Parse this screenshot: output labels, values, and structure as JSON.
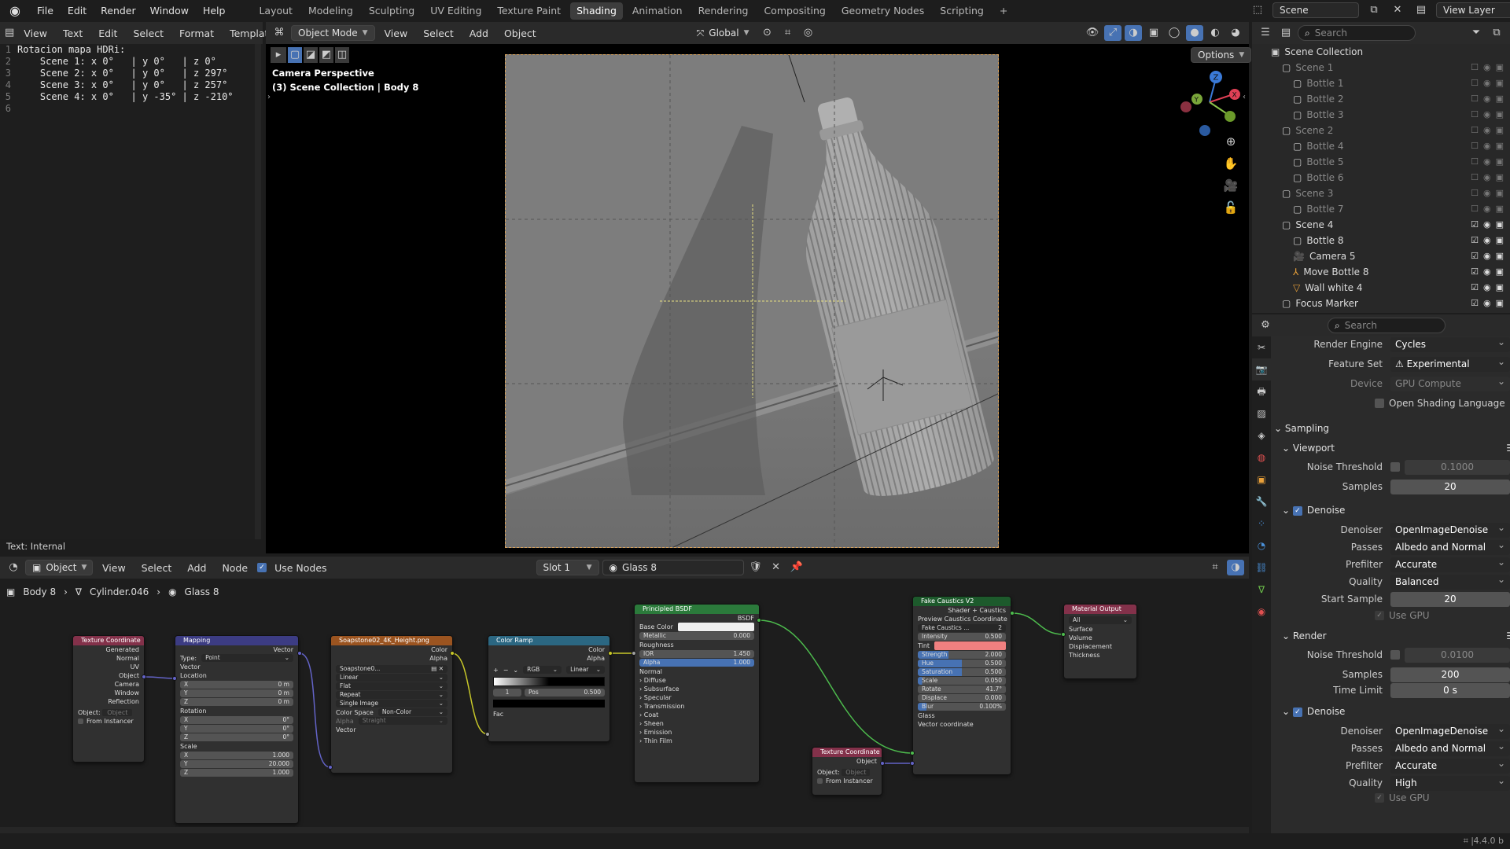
{
  "topbar": {
    "menus": [
      "File",
      "Edit",
      "Render",
      "Window",
      "Help"
    ],
    "workspaces": [
      "Layout",
      "Modeling",
      "Sculpting",
      "UV Editing",
      "Texture Paint",
      "Shading",
      "Animation",
      "Rendering",
      "Compositing",
      "Geometry Nodes",
      "Scripting"
    ],
    "active_workspace": "Shading",
    "scene": "Scene",
    "view_layer": "View Layer"
  },
  "text_editor": {
    "menus": [
      "View",
      "Text",
      "Edit",
      "Select",
      "Format",
      "Templates"
    ],
    "lines": [
      {
        "num": "1",
        "text": "Rotacion mapa HDRi:"
      },
      {
        "num": "2",
        "text": "    Scene 1: x 0°   | y 0°   | z 0°"
      },
      {
        "num": "3",
        "text": "    Scene 2: x 0°   | y 0°   | z 297°"
      },
      {
        "num": "4",
        "text": "    Scene 3: x 0°   | y 0°   | z 257°"
      },
      {
        "num": "5",
        "text": "    Scene 4: x 0°   | y -35° | z -210°"
      },
      {
        "num": "6",
        "text": ""
      }
    ],
    "status": "Text: Internal"
  },
  "viewport": {
    "mode": "Object Mode",
    "menus": [
      "View",
      "Select",
      "Add",
      "Object"
    ],
    "transform": "Global",
    "options": "Options",
    "overlay_title": "Camera Perspective",
    "overlay_sub": "(3) Scene Collection | Body 8",
    "axes": [
      "Z",
      "Y",
      "X"
    ]
  },
  "node_editor": {
    "type": "Object",
    "menus": [
      "View",
      "Select",
      "Add",
      "Node"
    ],
    "use_nodes": "Use Nodes",
    "slot": "Slot 1",
    "material": "Glass 8",
    "breadcrumb": [
      "Body 8",
      "Cylinder.046",
      "Glass 8"
    ],
    "nodes": {
      "texcoord": {
        "title": "Texture Coordinate",
        "outputs": [
          "Generated",
          "Normal",
          "UV",
          "Object",
          "Camera",
          "Window",
          "Reflection"
        ],
        "object_label": "Object:",
        "object_value": "Object",
        "from_instancer": "From Instancer"
      },
      "mapping": {
        "title": "Mapping",
        "vector_out": "Vector",
        "type_label": "Type:",
        "type_value": "Point",
        "vector_in": "Vector",
        "location": "Location",
        "rotation": "Rotation",
        "scale": "Scale",
        "loc": [
          {
            "a": "X",
            "v": "0 m"
          },
          {
            "a": "Y",
            "v": "0 m"
          },
          {
            "a": "Z",
            "v": "0 m"
          }
        ],
        "rot": [
          {
            "a": "X",
            "v": "0°"
          },
          {
            "a": "Y",
            "v": "0°"
          },
          {
            "a": "Z",
            "v": "0°"
          }
        ],
        "scl": [
          {
            "a": "X",
            "v": "1.000"
          },
          {
            "a": "Y",
            "v": "20.000"
          },
          {
            "a": "Z",
            "v": "1.000"
          }
        ]
      },
      "image": {
        "title": "Soapstone02_4K_Height.png",
        "color": "Color",
        "alpha": "Alpha",
        "file": "Soapstone0...",
        "interp": "Linear",
        "proj": "Flat",
        "ext": "Repeat",
        "source": "Single Image",
        "cs_label": "Color Space",
        "cs_value": "Non-Color",
        "alpha_label": "Alpha",
        "alpha_value": "Straight",
        "vector": "Vector"
      },
      "ramp": {
        "title": "Color Ramp",
        "color": "Color",
        "alpha": "Alpha",
        "mode": "RGB",
        "interp": "Linear",
        "index": "1",
        "pos_label": "Pos",
        "pos": "0.500",
        "fac": "Fac"
      },
      "bsdf": {
        "title": "Principled BSDF",
        "out": "BSDF",
        "base_color": "Base Color",
        "metallic": "Metallic",
        "metallic_v": "0.000",
        "roughness": "Roughness",
        "ior": "IOR",
        "ior_v": "1.450",
        "alpha": "Alpha",
        "alpha_v": "1.000",
        "normal": "Normal",
        "panels": [
          "Diffuse",
          "Subsurface",
          "Specular",
          "Transmission",
          "Coat",
          "Sheen",
          "Emission",
          "Thin Film"
        ]
      },
      "texcoord2": {
        "title": "Texture Coordinate",
        "object": "Object",
        "object_label": "Object:",
        "object_value": "Object",
        "from_instancer": "From Instancer"
      },
      "caustics": {
        "title": "Fake Caustics V2",
        "out1": "Shader + Caustics",
        "out2": "Preview Caustics Coordinate",
        "group": "Fake Caustics ...",
        "group_users": "2",
        "fields": [
          {
            "a": "Intensity",
            "v": "0.500"
          },
          {
            "a": "Tint",
            "v": ""
          },
          {
            "a": "Strength",
            "v": "2.000"
          },
          {
            "a": "Hue",
            "v": "0.500"
          },
          {
            "a": "Saturation",
            "v": "0.500"
          },
          {
            "a": "Scale",
            "v": "0.050"
          },
          {
            "a": "Rotate",
            "v": "41.7°"
          },
          {
            "a": "Displace",
            "v": "0.000"
          },
          {
            "a": "Blur",
            "v": "0.100%"
          }
        ],
        "glass": "Glass",
        "vcoord": "Vector coordinate"
      },
      "output": {
        "title": "Material Output",
        "target": "All",
        "inputs": [
          "Surface",
          "Volume",
          "Displacement",
          "Thickness"
        ]
      }
    }
  },
  "outliner": {
    "search": "Search",
    "root": "Scene Collection",
    "rows": [
      {
        "label": "Scene 1",
        "indent": 1,
        "dim": true,
        "kind": "coll"
      },
      {
        "label": "Bottle 1",
        "indent": 2,
        "dim": true,
        "kind": "coll"
      },
      {
        "label": "Bottle 2",
        "indent": 2,
        "dim": true,
        "kind": "coll"
      },
      {
        "label": "Bottle 3",
        "indent": 2,
        "dim": true,
        "kind": "coll"
      },
      {
        "label": "Scene 2",
        "indent": 1,
        "dim": true,
        "kind": "coll"
      },
      {
        "label": "Bottle 4",
        "indent": 2,
        "dim": true,
        "kind": "coll"
      },
      {
        "label": "Bottle 5",
        "indent": 2,
        "dim": true,
        "kind": "coll"
      },
      {
        "label": "Bottle 6",
        "indent": 2,
        "dim": true,
        "kind": "coll"
      },
      {
        "label": "Scene 3",
        "indent": 1,
        "dim": true,
        "kind": "coll"
      },
      {
        "label": "Bottle 7",
        "indent": 2,
        "dim": true,
        "kind": "coll"
      },
      {
        "label": "Scene 4",
        "indent": 1,
        "dim": false,
        "kind": "coll"
      },
      {
        "label": "Bottle 8",
        "indent": 2,
        "dim": false,
        "kind": "coll"
      },
      {
        "label": "Camera 5",
        "indent": 2,
        "dim": false,
        "kind": "cam"
      },
      {
        "label": "Move Bottle 8",
        "indent": 2,
        "dim": false,
        "kind": "empty"
      },
      {
        "label": "Wall white 4",
        "indent": 2,
        "dim": false,
        "kind": "mesh"
      },
      {
        "label": "Focus Marker",
        "indent": 1,
        "dim": false,
        "kind": "coll"
      }
    ]
  },
  "properties": {
    "search": "Search",
    "render_engine_label": "Render Engine",
    "render_engine": "Cycles",
    "feature_set_label": "Feature Set",
    "feature_set": "Experimental",
    "device_label": "Device",
    "device": "GPU Compute",
    "osl": "Open Shading Language",
    "sampling": "Sampling",
    "viewport": "Viewport",
    "render": "Render",
    "noise_threshold_label": "Noise Threshold",
    "vp_noise": "0.1000",
    "samples_label": "Samples",
    "vp_samples": "20",
    "denoise": "Denoise",
    "denoiser_label": "Denoiser",
    "denoiser": "OpenImageDenoise",
    "passes_label": "Passes",
    "passes": "Albedo and Normal",
    "prefilter_label": "Prefilter",
    "prefilter": "Accurate",
    "quality_label": "Quality",
    "vp_quality": "Balanced",
    "start_sample_label": "Start Sample",
    "start_sample": "20",
    "use_gpu": "Use GPU",
    "r_noise": "0.0100",
    "r_samples": "200",
    "time_limit_label": "Time Limit",
    "time_limit": "0 s",
    "r_quality": "High"
  },
  "statusbar": {
    "version": "4.4.0 b"
  }
}
